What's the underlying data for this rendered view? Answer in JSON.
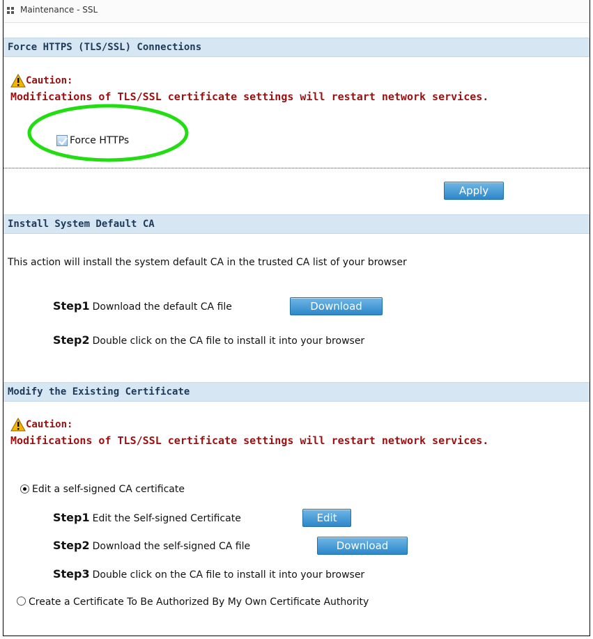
{
  "window": {
    "title": "Maintenance - SSL"
  },
  "force_https": {
    "header": "Force HTTPS (TLS/SSL) Connections",
    "caution_title": "Caution:",
    "caution_message": "Modifications of TLS/SSL certificate settings will restart network services.",
    "checkbox_label": "Force HTTPs",
    "checkbox_checked": true,
    "apply_label": "Apply"
  },
  "install_ca": {
    "header": "Install System Default CA",
    "description": "This action will install the system default CA in the trusted CA list of your browser",
    "steps": [
      {
        "label": "Step1",
        "text": "Download the default CA file",
        "button": "Download"
      },
      {
        "label": "Step2",
        "text": "Double click on the CA file to install it into your browser"
      }
    ]
  },
  "modify_cert": {
    "header": "Modify the Existing Certificate",
    "caution_title": "Caution:",
    "caution_message": "Modifications of TLS/SSL certificate settings will restart network services.",
    "options": [
      {
        "label": "Edit a self-signed CA certificate",
        "selected": true
      },
      {
        "label": "Create a Certificate To Be Authorized By My Own Certificate Authority",
        "selected": false
      }
    ],
    "steps": [
      {
        "label": "Step1",
        "text": "Edit the Self-signed Certificate",
        "button": "Edit"
      },
      {
        "label": "Step2",
        "text": "Download the self-signed CA file",
        "button": "Download"
      },
      {
        "label": "Step3",
        "text": "Double click on the CA file to install it into your browser"
      }
    ]
  },
  "colors": {
    "header_bg": "#d6e6f3",
    "caution": "#9a1010",
    "button": "#2d87c9",
    "highlight_ring": "#22dd11"
  }
}
